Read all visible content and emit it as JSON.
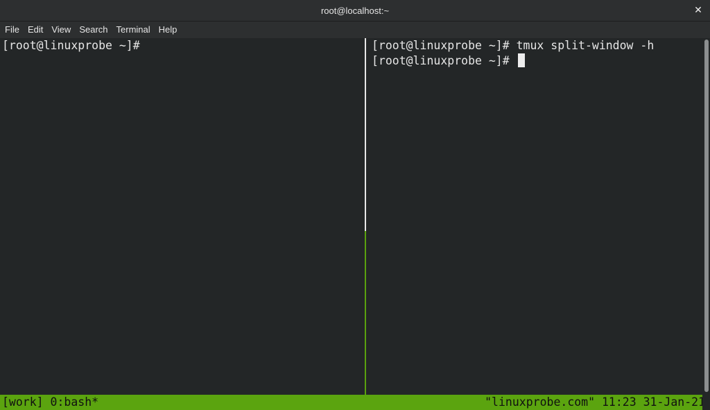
{
  "window": {
    "title": "root@localhost:~",
    "close_glyph": "✕"
  },
  "menu": {
    "items": [
      "File",
      "Edit",
      "View",
      "Search",
      "Terminal",
      "Help"
    ]
  },
  "panes": {
    "left": {
      "lines": [
        "[root@linuxprobe ~]#"
      ]
    },
    "right": {
      "lines": [
        "[root@linuxprobe ~]# tmux split-window -h",
        "[root@linuxprobe ~]# "
      ]
    }
  },
  "status": {
    "left": "[work] 0:bash*",
    "right": "\"linuxprobe.com\" 11:23 31-Jan-21"
  },
  "colors": {
    "terminal_bg": "#232627",
    "status_bg": "#5ba40f",
    "active_divider": "#5aa10e"
  }
}
